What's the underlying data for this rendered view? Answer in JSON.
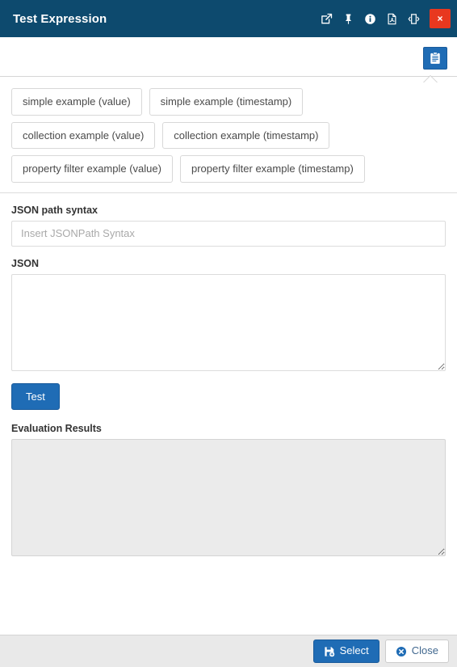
{
  "window": {
    "title": "Test Expression",
    "titlebar_icons": [
      {
        "name": "open-in-new-window-icon",
        "label": "Open in new window"
      },
      {
        "name": "pin-icon",
        "label": "Pin"
      },
      {
        "name": "info-icon",
        "label": "Information"
      },
      {
        "name": "pdf-export-icon",
        "label": "Export as PDF"
      },
      {
        "name": "collapse-expand-icon",
        "label": "Collapse / Expand"
      }
    ],
    "close_label": "×"
  },
  "toolbar": {
    "clipboard_button": {
      "name": "clipboard-examples-icon",
      "label": "Examples"
    }
  },
  "examples": {
    "rows": [
      [
        {
          "label": "simple example (value)"
        },
        {
          "label": "simple example (timestamp)"
        }
      ],
      [
        {
          "label": "collection example (value)"
        },
        {
          "label": "collection example (timestamp)"
        }
      ],
      [
        {
          "label": "property filter example (value)"
        },
        {
          "label": "property filter example (timestamp)"
        }
      ]
    ]
  },
  "form": {
    "jsonpath": {
      "label": "JSON path syntax",
      "placeholder": "Insert JSONPath Syntax",
      "value": ""
    },
    "json": {
      "label": "JSON",
      "placeholder": "",
      "value": ""
    },
    "test_button": {
      "label": "Test"
    },
    "evaluation": {
      "label": "Evaluation Results",
      "placeholder": "",
      "value": ""
    }
  },
  "footer": {
    "select_label": "Select",
    "close_label": "Close"
  },
  "colors": {
    "titlebar_bg": "#0d4a6e",
    "close_red": "#e8381f",
    "primary_blue": "#1f6cb5",
    "footer_bg": "#e9e9e9",
    "readonly_bg": "#ebebeb",
    "link_blue": "#41688f"
  }
}
